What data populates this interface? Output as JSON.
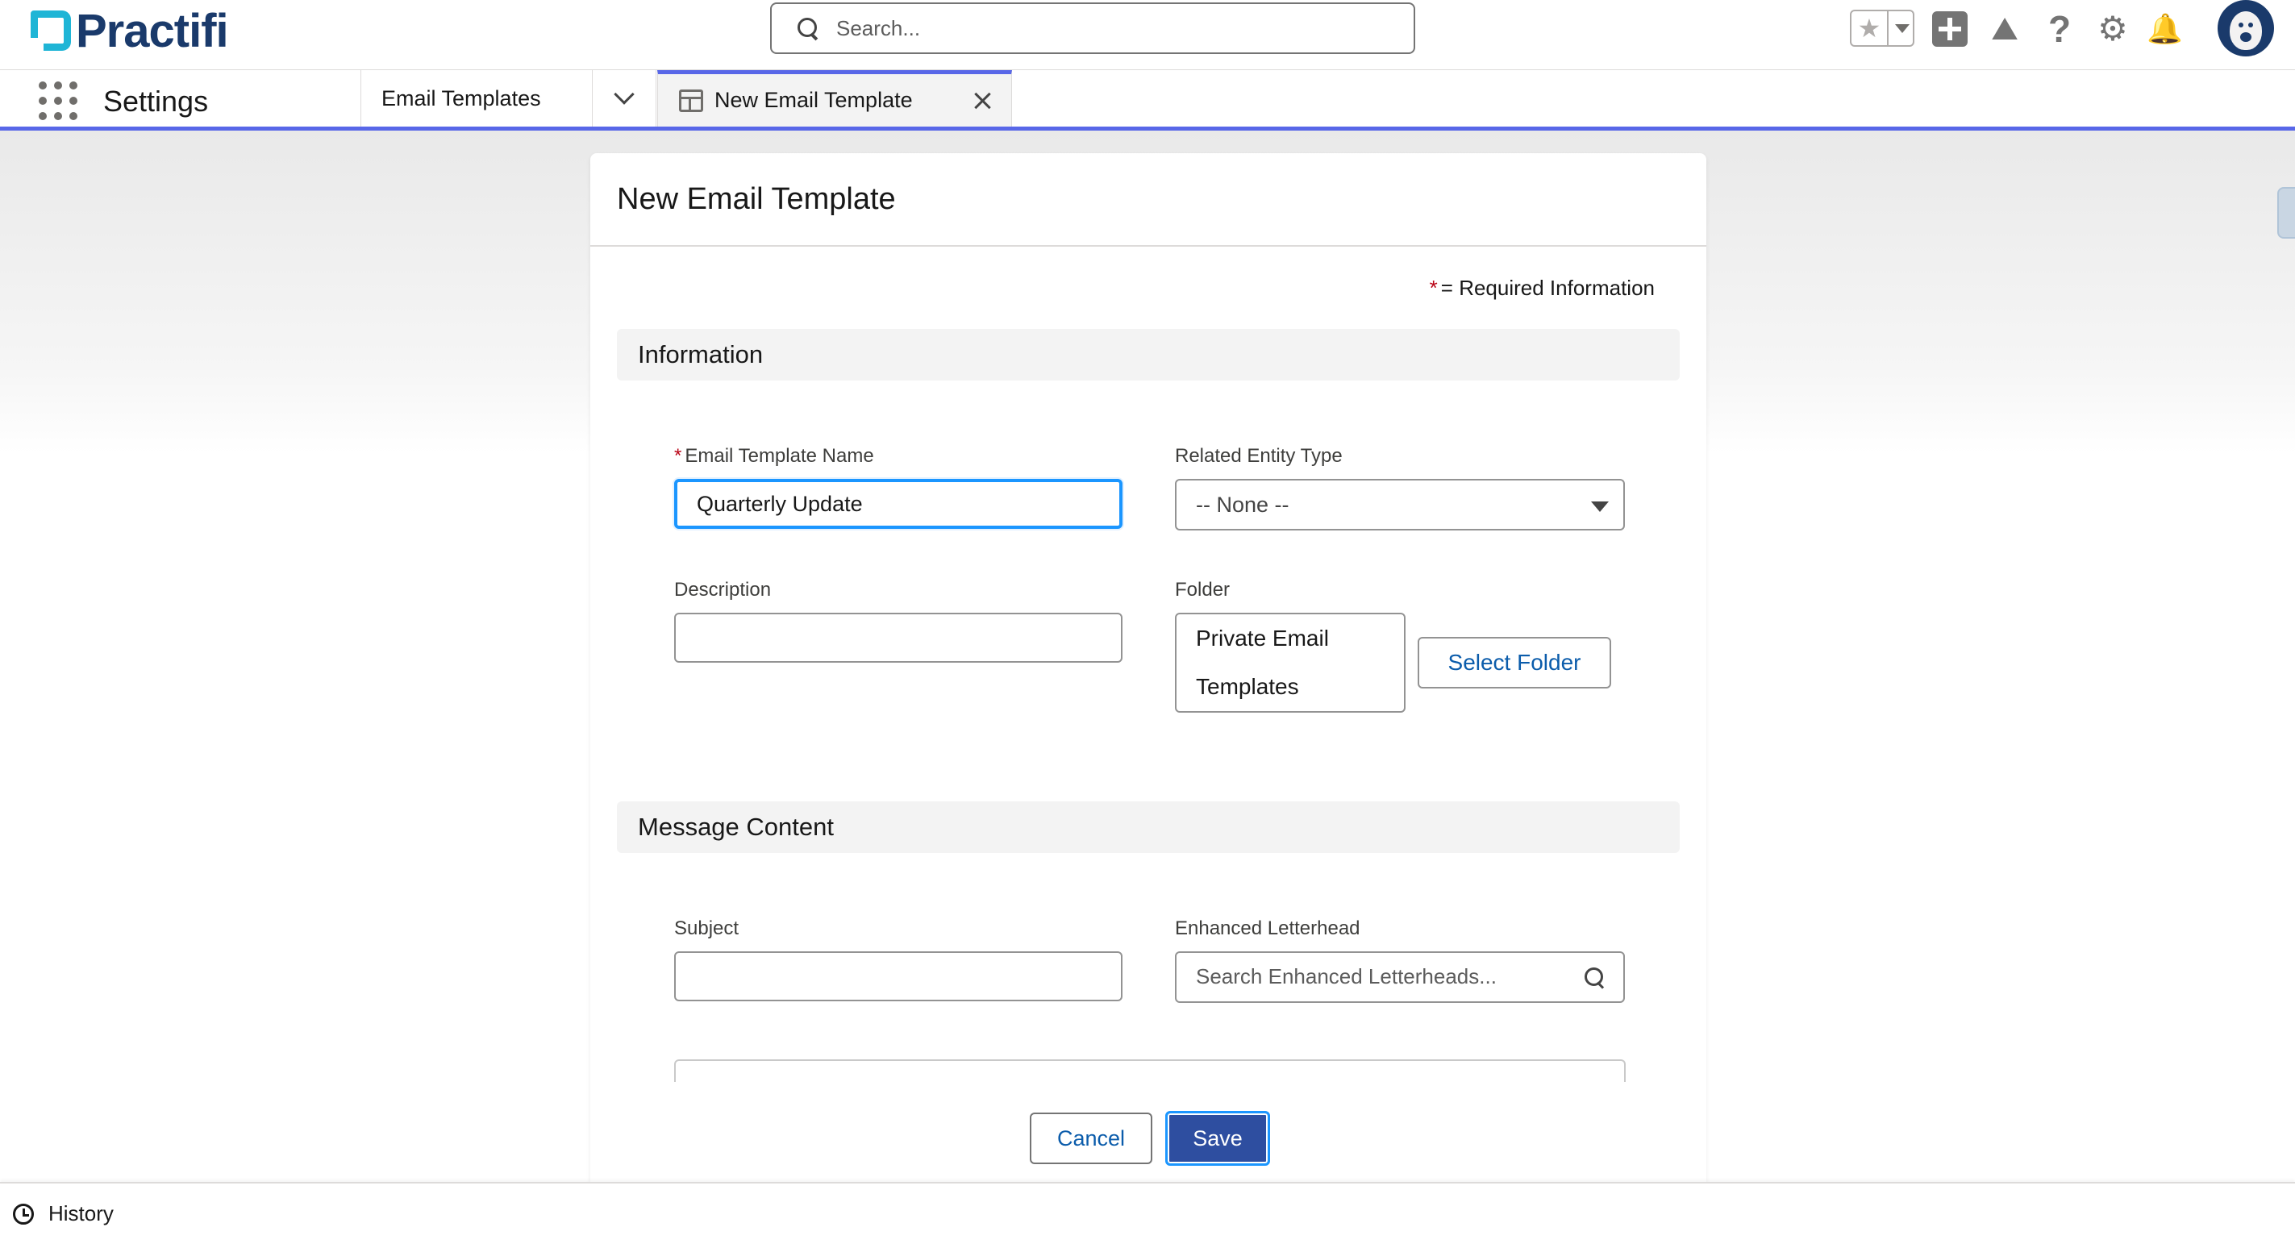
{
  "brand": {
    "name": "Practifi",
    "primary_color": "#1a3a6b",
    "accent_color": "#1fb5d6"
  },
  "global_search": {
    "placeholder": "Search..."
  },
  "header_icons": [
    "favorites-star-icon",
    "global-actions-plus-icon",
    "trailhead-icon",
    "help-icon",
    "setup-gear-icon",
    "notifications-bell-icon",
    "user-avatar"
  ],
  "nav": {
    "app_name": "Settings",
    "tabs": [
      {
        "label": "Email Templates"
      },
      {
        "label": "New Email Template",
        "active": true
      }
    ],
    "active_color": "#5867e8"
  },
  "modal": {
    "title": "New Email Template",
    "required_note": {
      "star": "*",
      "text": "= Required Information"
    },
    "sections": {
      "information": {
        "title": "Information"
      },
      "message_content": {
        "title": "Message Content"
      }
    },
    "fields": {
      "template_name": {
        "label": "Email Template Name",
        "required_star": "*",
        "value": "Quarterly Update"
      },
      "related_entity_type": {
        "label": "Related Entity Type",
        "value": "-- None --"
      },
      "description": {
        "label": "Description",
        "value": ""
      },
      "folder": {
        "label": "Folder",
        "value_line1": "Private Email",
        "value_line2": "Templates",
        "button_label": "Select Folder"
      },
      "subject": {
        "label": "Subject",
        "value": ""
      },
      "enhanced_letterhead": {
        "label": "Enhanced Letterhead",
        "placeholder": "Search Enhanced Letterheads..."
      }
    },
    "footer": {
      "cancel_label": "Cancel",
      "save_label": "Save"
    }
  },
  "utility_bar": {
    "history_label": "History"
  }
}
